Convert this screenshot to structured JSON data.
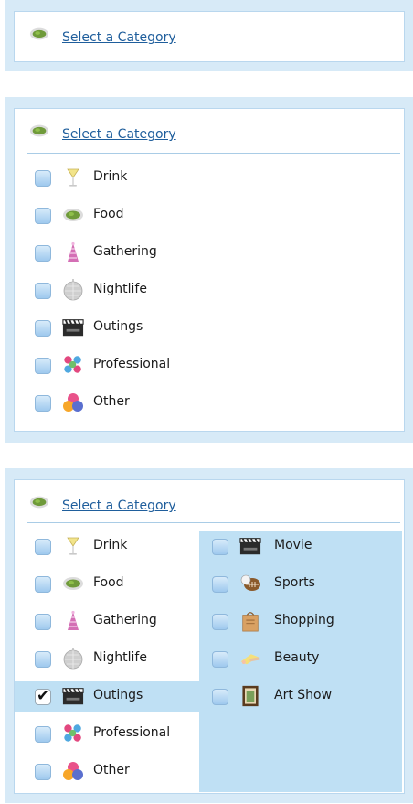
{
  "header": {
    "link_label": "Select a Category",
    "icon": "food-icon"
  },
  "categories": [
    {
      "label": "Drink",
      "icon": "cocktail-icon"
    },
    {
      "label": "Food",
      "icon": "food-icon"
    },
    {
      "label": "Gathering",
      "icon": "party-hat-icon"
    },
    {
      "label": "Nightlife",
      "icon": "disco-ball-icon"
    },
    {
      "label": "Outings",
      "icon": "clapperboard-icon"
    },
    {
      "label": "Professional",
      "icon": "people-icon"
    },
    {
      "label": "Other",
      "icon": "shapes-icon"
    }
  ],
  "selected_category": "Outings",
  "subcategories": [
    {
      "label": "Movie",
      "icon": "clapperboard-icon"
    },
    {
      "label": "Sports",
      "icon": "ball-icon"
    },
    {
      "label": "Shopping",
      "icon": "shopping-bag-icon"
    },
    {
      "label": "Beauty",
      "icon": "makeup-icon"
    },
    {
      "label": "Art Show",
      "icon": "picture-frame-icon"
    }
  ],
  "colors": {
    "panel_bg": "#d7eaf7",
    "panel_border": "#b9d7ee",
    "link": "#1f5e9c",
    "selection": "#bfe0f4"
  }
}
